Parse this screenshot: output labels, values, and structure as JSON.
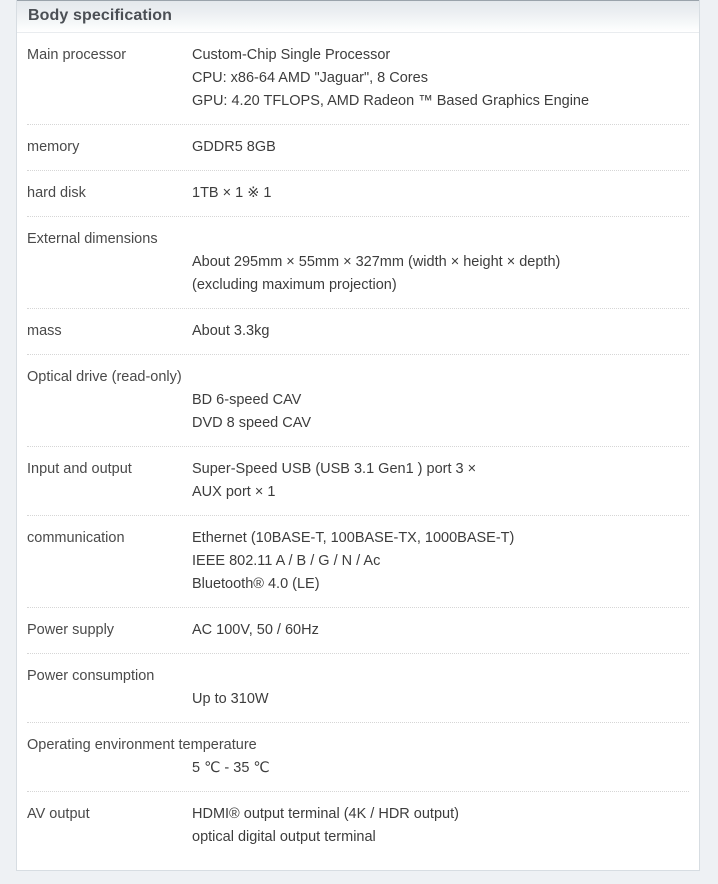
{
  "panel": {
    "header_title": "Body specification",
    "accent_border_color": "#9aa3ab",
    "background_color": "#ffffff",
    "page_background_color": "#eef1f4",
    "separator_color": "#d6d6d6"
  },
  "spec_rows": [
    {
      "label": "Main processor",
      "layout": "inline",
      "lines": [
        "Custom-Chip Single Processor",
        "CPU: x86-64 AMD \"Jaguar\", 8 Cores",
        "GPU: 4.20 TFLOPS, AMD Radeon ™ Based Graphics Engine"
      ]
    },
    {
      "label": "memory",
      "layout": "inline",
      "lines": [
        "GDDR5 8GB"
      ]
    },
    {
      "label": "hard disk",
      "layout": "inline",
      "lines": [
        "1TB × 1 ※ 1"
      ]
    },
    {
      "label": "External dimensions",
      "layout": "stacked",
      "lines": [
        "About 295mm × 55mm × 327mm (width × height × depth)",
        "(excluding maximum projection)"
      ]
    },
    {
      "label": "mass",
      "layout": "inline",
      "lines": [
        "About 3.3kg"
      ]
    },
    {
      "label": "Optical drive (read-only)",
      "layout": "stacked",
      "lines": [
        "BD 6-speed CAV",
        "DVD 8 speed CAV"
      ]
    },
    {
      "label": "Input and output",
      "layout": "inline",
      "lines": [
        "Super-Speed USB (USB 3.1 Gen1 ) port 3 ×",
        "AUX port × 1"
      ]
    },
    {
      "label": "communication",
      "layout": "inline",
      "lines": [
        "Ethernet (10BASE-T, 100BASE-TX, 1000BASE-T)",
        "IEEE 802.11 A / B / G / N / Ac",
        "Bluetooth® 4.0 (LE)"
      ]
    },
    {
      "label": "Power supply",
      "layout": "inline",
      "lines": [
        "AC 100V, 50 / 60Hz"
      ]
    },
    {
      "label": "Power consumption",
      "layout": "stacked",
      "lines": [
        "Up to 310W"
      ]
    },
    {
      "label": "Operating environment temperature",
      "layout": "stacked",
      "lines": [
        "5 ℃ - 35 ℃"
      ]
    },
    {
      "label": "AV output",
      "layout": "inline",
      "lines": [
        "HDMI® output terminal (4K / HDR output)",
        "optical digital output terminal"
      ]
    }
  ]
}
